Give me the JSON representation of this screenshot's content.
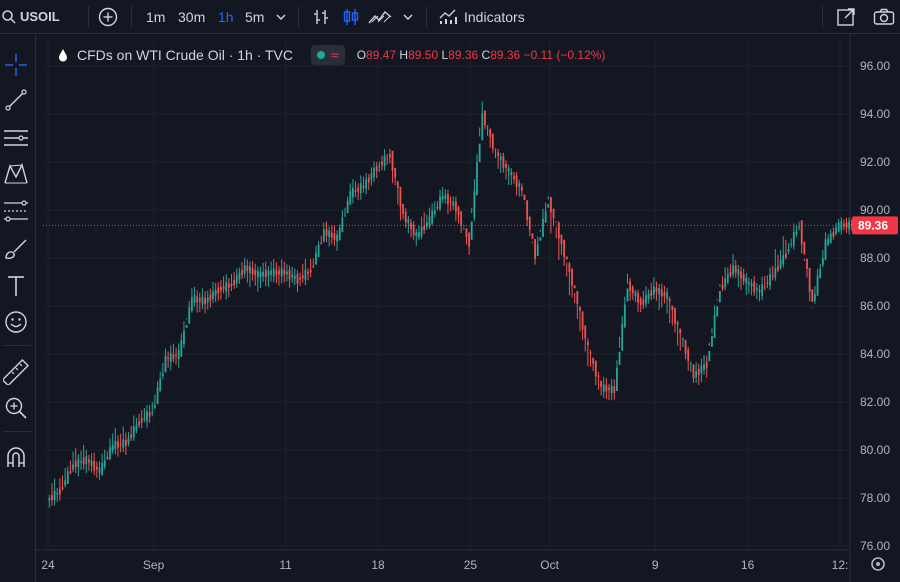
{
  "toolbar": {
    "symbol": "USOIL",
    "intervals": [
      "1m",
      "30m",
      "1h",
      "5m"
    ],
    "active_interval": "1h",
    "indicators_label": "Indicators"
  },
  "legend": {
    "title": "CFDs on WTI Crude Oil · 1h · TVC",
    "open_label": "O",
    "open": "89.47",
    "high_label": "H",
    "high": "89.50",
    "low_label": "L",
    "low": "89.36",
    "close_label": "C",
    "close": "89.36",
    "change": "−0.11 (−0.12%)"
  },
  "colors": {
    "background": "#131722",
    "up": "#26a69a",
    "down": "#ef5350",
    "active_interval": "#2962ff",
    "price_label": "#f23645"
  },
  "chart_data": {
    "type": "line",
    "y_ticks": [
      "96.00",
      "94.00",
      "92.00",
      "90.00",
      "88.00",
      "86.00",
      "84.00",
      "82.00",
      "80.00",
      "78.00",
      "76.00"
    ],
    "ylim": [
      76,
      96.5
    ],
    "x_ticks": [
      {
        "label": "24",
        "x": 0
      },
      {
        "label": "Sep",
        "x": 8
      },
      {
        "label": "11",
        "x": 18
      },
      {
        "label": "18",
        "x": 25
      },
      {
        "label": "25",
        "x": 32
      },
      {
        "label": "Oct",
        "x": 38
      },
      {
        "label": "9",
        "x": 46
      },
      {
        "label": "16",
        "x": 53
      },
      {
        "label": "12:",
        "x": 60
      }
    ],
    "last_price": "89.36",
    "series": [
      {
        "x": [
          0,
          1,
          2,
          3,
          4,
          5,
          6,
          7,
          8,
          9,
          10,
          11,
          12,
          13,
          14,
          15,
          16,
          17,
          18,
          19,
          20,
          21,
          22,
          23,
          24,
          25,
          26,
          27,
          28,
          29,
          30,
          31,
          32,
          33,
          34,
          35,
          36,
          37,
          38,
          39,
          40,
          41,
          42,
          43,
          44,
          45,
          46,
          47,
          48,
          49,
          50,
          51,
          52,
          53,
          54,
          55,
          56,
          57,
          58,
          59,
          60
        ],
        "values": [
          78.3,
          79.4,
          79.6,
          79.1,
          80.2,
          80.3,
          81.2,
          81.6,
          83.8,
          84.0,
          86.3,
          86.2,
          86.7,
          86.9,
          87.6,
          87.3,
          87.4,
          87.4,
          87.1,
          87.5,
          89.1,
          88.8,
          90.7,
          91.0,
          91.8,
          92.3,
          89.8,
          88.9,
          89.6,
          90.6,
          90.1,
          88.6,
          94.0,
          92.4,
          91.6,
          90.8,
          88.1,
          90.4,
          88.6,
          86.6,
          84.2,
          82.6,
          82.5,
          86.9,
          86.1,
          86.7,
          86.4,
          84.8,
          83.1,
          83.6,
          86.7,
          87.6,
          87.0,
          86.6,
          87.3,
          88.2,
          89.4,
          86.1,
          88.6,
          89.36,
          89.36
        ],
        "high": [
          79.3,
          80.4,
          80.6,
          80.1,
          81.0,
          81.3,
          82.0,
          82.3,
          84.5,
          84.7,
          86.9,
          86.8,
          87.3,
          87.6,
          88.1,
          88.0,
          88.0,
          88.0,
          87.9,
          88.4,
          89.5,
          89.6,
          91.2,
          91.6,
          92.1,
          92.6,
          91.3,
          89.8,
          90.6,
          91.2,
          90.8,
          89.5,
          94.9,
          93.3,
          92.4,
          91.6,
          89.5,
          91.1,
          89.1,
          87.2,
          85.0,
          83.4,
          83.0,
          87.4,
          86.7,
          87.3,
          87.0,
          85.5,
          84.5,
          84.2,
          87.3,
          88.4,
          87.8,
          87.2,
          88.0,
          89.8,
          89.9,
          87.0,
          89.1,
          89.5,
          89.5
        ],
        "low": [
          77.5,
          78.7,
          78.8,
          78.6,
          79.5,
          79.6,
          80.4,
          80.9,
          83.0,
          83.2,
          85.5,
          85.4,
          85.8,
          86.1,
          86.8,
          86.2,
          86.5,
          86.6,
          86.6,
          86.8,
          88.0,
          88.2,
          89.8,
          90.2,
          90.6,
          91.5,
          88.4,
          88.2,
          89.0,
          89.8,
          89.4,
          88.1,
          93.0,
          91.6,
          90.5,
          90.1,
          87.8,
          89.7,
          86.7,
          84.5,
          82.4,
          81.6,
          81.8,
          85.8,
          85.5,
          86.0,
          85.2,
          82.9,
          82.4,
          82.4,
          86.0,
          86.9,
          86.0,
          85.9,
          86.5,
          87.5,
          88.3,
          85.5,
          86.6,
          88.9,
          89.2
        ]
      }
    ]
  }
}
